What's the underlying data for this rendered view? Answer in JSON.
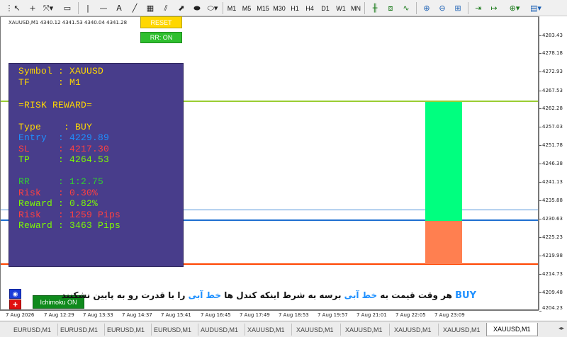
{
  "toolbar": {
    "timeframes": [
      "M1",
      "M5",
      "M15",
      "M30",
      "H1",
      "H4",
      "D1",
      "W1",
      "MN"
    ]
  },
  "chart": {
    "symbol_line": "XAUUSD,M1  4340.12 4341.53 4340.04 4341.28",
    "price_labels": [
      "4283.43",
      "4278.18",
      "4272.93",
      "4267.53",
      "4262.28",
      "4257.03",
      "4251.78",
      "4246.38",
      "4241.13",
      "4235.88",
      "4230.63",
      "4225.23",
      "4219.98",
      "4214.73",
      "4209.48",
      "4204.23"
    ],
    "time_labels": [
      "7 Aug 2026",
      "7 Aug 12:29",
      "7 Aug 13:33",
      "7 Aug 14:37",
      "7 Aug 15:41",
      "7 Aug 16:45",
      "7 Aug 17:49",
      "7 Aug 18:53",
      "7 Aug 19:57",
      "7 Aug 21:01",
      "7 Aug 22:05",
      "7 Aug 23:09"
    ],
    "colors": {
      "tp_line": "#9acd32",
      "entry_line_upper": "#4a90d9",
      "entry_line_lower": "#1e6fd0",
      "sl_line": "#ff4500",
      "tp_zone": "#00ff7f",
      "sl_zone": "#ff7f50"
    }
  },
  "buttons": {
    "reset": "RESET",
    "rr": "RR: ON",
    "ichimoku": "Ichimoku ON",
    "eye_icon": "eye-icon",
    "plus_icon": "plus-icon"
  },
  "panel": {
    "symbol": "Symbol : XAUUSD",
    "tf": "TF     : M1",
    "heading": "=RISK REWARD=",
    "type": "Type    : BUY",
    "entry": "Entry  : 4229.89",
    "sl": "SL     : 4217.30",
    "tp": "TP     : 4264.53",
    "rr": "RR     : 1:2.75",
    "risk_pct": "Risk   : 0.30%",
    "reward_pct": "Reward : 0.82%",
    "risk_pips": "Risk   : 1259 Pips",
    "reward_pips": "Reward : 3463 Pips",
    "colors": {
      "background": "#483d8b",
      "gold": "#ffd700",
      "red": "#ff4040",
      "green": "#7cfc00",
      "blue": "#1e90ff",
      "teal": "#32cd32",
      "white": "#f0f0f0"
    }
  },
  "note": {
    "buy": "BUY",
    "part1": "هر وقت قیمت به",
    "blue_line_1": "خط آبی",
    "part2": "برسه به شرط اینکه کندل ها",
    "blue_line_2": "خط آبی",
    "part3": "را با قدرت رو به پایین نشکنند"
  },
  "tabs": [
    "EURUSD,M1",
    "EURUSD,M1",
    "EURUSD,M1",
    "EURUSD,M1",
    "AUDUSD,M1",
    "XAUUSD,M1",
    "XAUUSD,M1",
    "XAUUSD,M1",
    "XAUUSD,M1",
    "XAUUSD,M1",
    "XAUUSD,M1"
  ]
}
